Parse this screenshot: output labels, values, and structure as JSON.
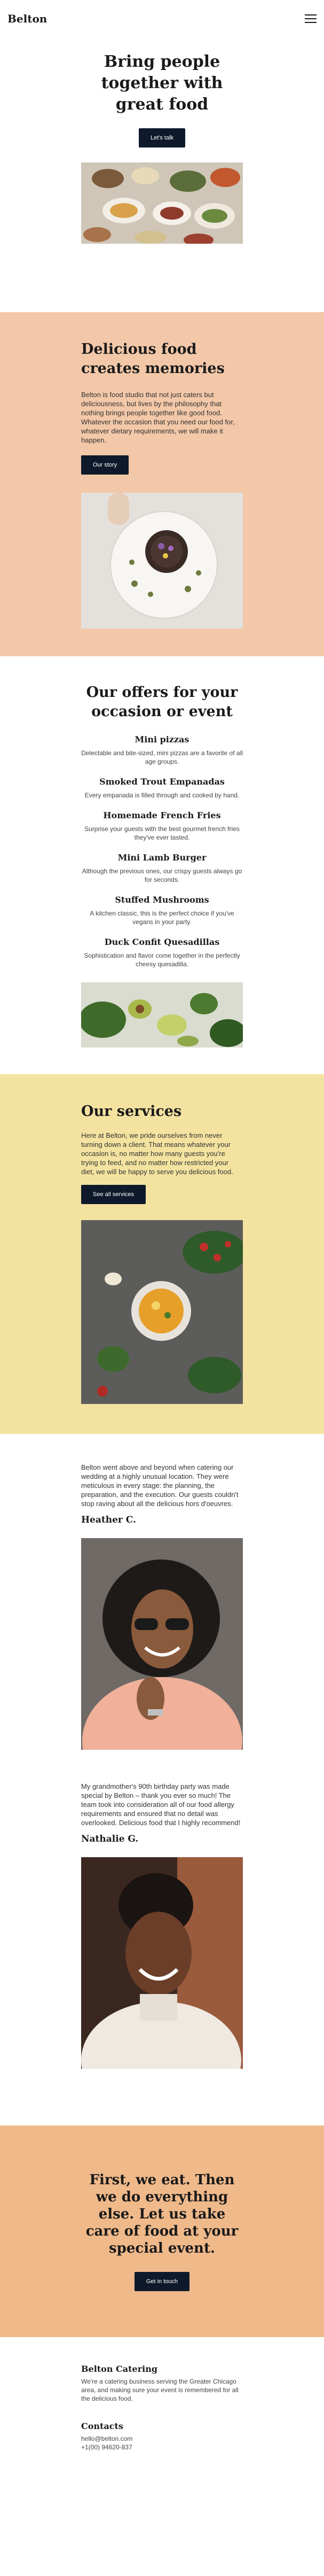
{
  "header": {
    "logo": "Belton",
    "menu_icon": "hamburger-menu-icon"
  },
  "hero": {
    "title": "Bring people together with great food",
    "button": "Let's talk",
    "image": "catering-table-photo"
  },
  "memories": {
    "title": "Delicious food creates memories",
    "body": "Belton is food studio that not just caters but deliciousness, but lives by the philosophy that nothing brings people together like good food. Whatever the occasion that you need our food for, whatever dietary requirements, we will make it happen.",
    "button": "Our story",
    "image": "plated-dish-photo"
  },
  "offers": {
    "title": "Our offers for your occasion or event",
    "items": [
      {
        "name": "Mini pizzas",
        "desc": "Delectable and bite-sized, mini pizzas are a favorite of all age groups."
      },
      {
        "name": "Smoked Trout Empanadas",
        "desc": "Every empanada is filled through and cooked by hand."
      },
      {
        "name": "Homemade French Fries",
        "desc": "Surprise your guests with the best gourmet french fries they've ever tasted."
      },
      {
        "name": "Mini Lamb Burger",
        "desc": "Although the previous ones, our crispy guests always go for seconds."
      },
      {
        "name": "Stuffed Mushrooms",
        "desc": "A kitchen classic, this is the perfect choice if you've vegans in your party."
      },
      {
        "name": "Duck Confit Quesadillas",
        "desc": "Sophistication and flavor come together in the perfectly cheesy quesadilla."
      }
    ],
    "image": "avocado-greens-photo"
  },
  "services": {
    "title": "Our services",
    "body": "Here at Belton, we pride ourselves from never turning down a client. That means whatever your occasion is, no matter how many guests you're trying to feed, and no matter how restricted your diet, we will be happy to serve you delicious food.",
    "button": "See all services",
    "image": "soup-bowl-photo"
  },
  "testimonials": [
    {
      "quote": "Belton went above and beyond when catering our wedding at a highly unusual location. They were meticulous in every stage: the planning, the preparation, and the execution. Our guests couldn't stop raving about all the delicious hors d'oeuvres.",
      "name": "Heather C.",
      "image": "heather-portrait-photo"
    },
    {
      "quote": "My grandmother's 90th birthday party was made special by Belton – thank you ever so much! The team took into consideration all of our food allergy requirements and ensured that no detail was overlooked. Delicious food that I highly recommend!",
      "name": "Nathalie G.",
      "image": "nathalie-portrait-photo"
    }
  ],
  "cta": {
    "title": "First, we eat. Then we do everything else. Let us take care of food at your special event.",
    "button": "Get in touch"
  },
  "footer": {
    "about_title": "Belton Catering",
    "about_body": "We're a catering business serving the Greater Chicago area, and making sure your event is remembered for all the delicious food.",
    "contact_title": "Contacts",
    "email": "hello@belton.com",
    "phone": "+1(00) 94620-837"
  },
  "colors": {
    "peach": "#f3c8a8",
    "yellow": "#f4e3a0",
    "orange": "#f0b98a",
    "navy_button": "#0e1a2b"
  }
}
